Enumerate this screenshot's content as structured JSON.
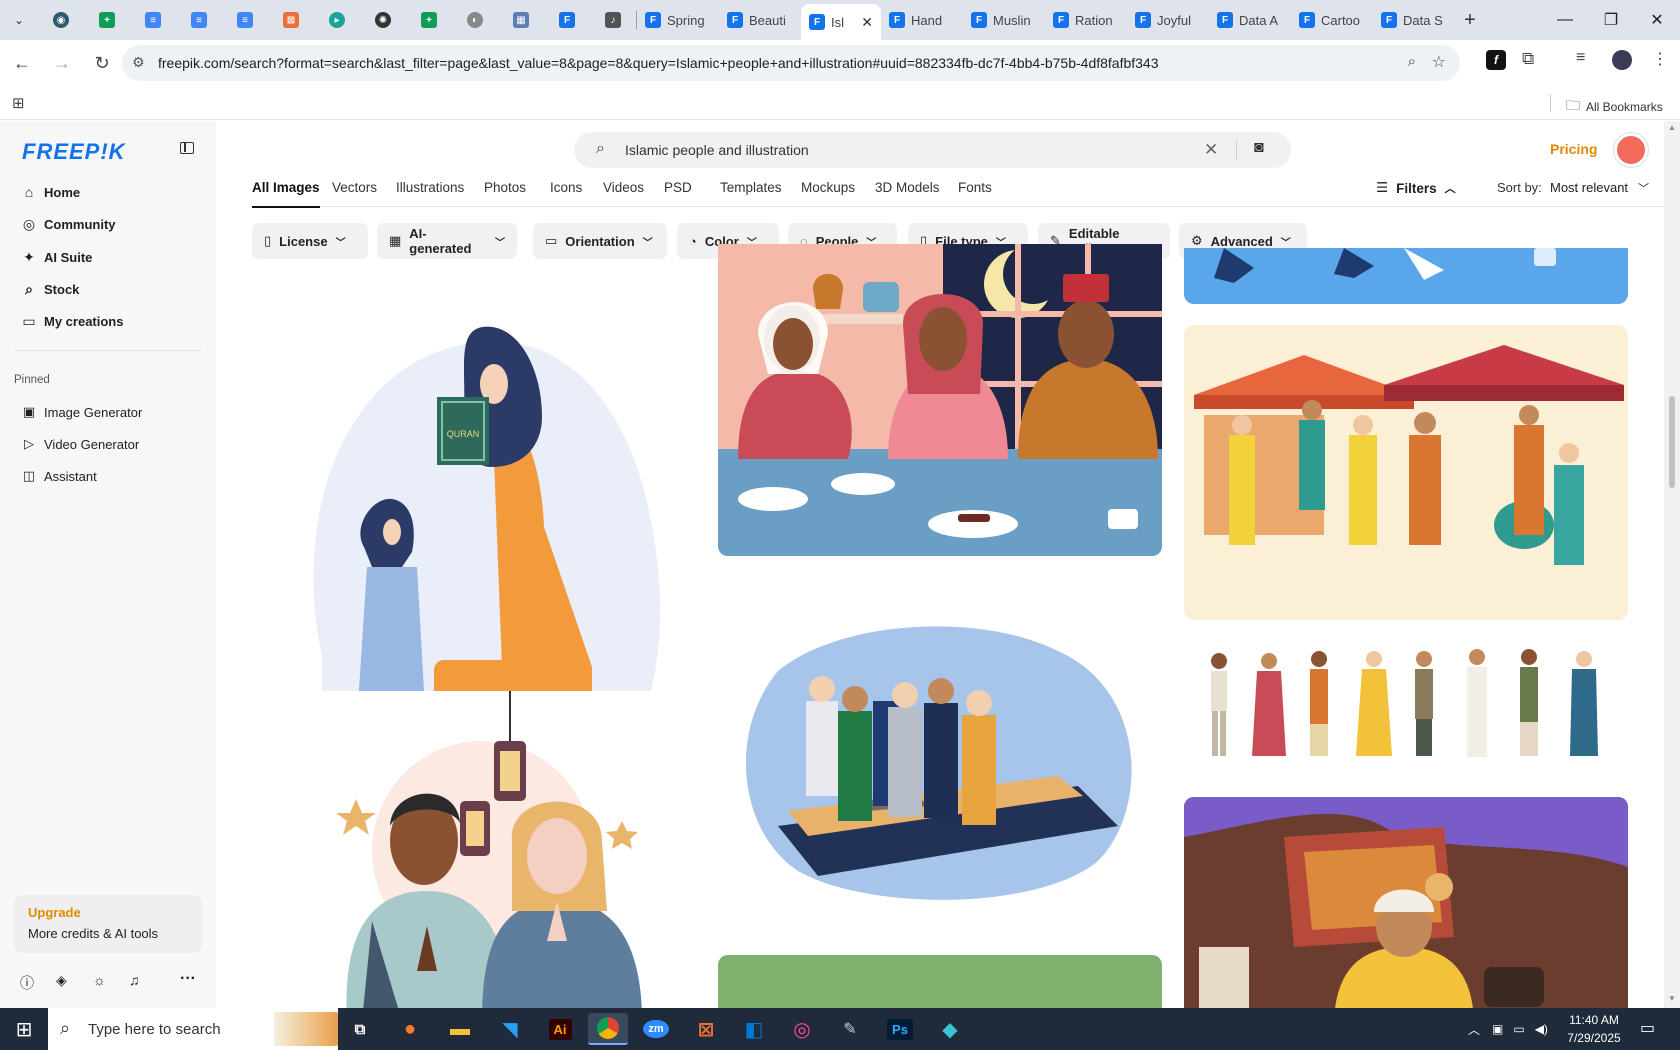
{
  "browser": {
    "tabs": [
      {
        "label": "Spring"
      },
      {
        "label": "Beauti"
      },
      {
        "label": "Isl"
      },
      {
        "label": "Hand"
      },
      {
        "label": "Muslin"
      },
      {
        "label": "Ration"
      },
      {
        "label": "Joyful"
      },
      {
        "label": "Data A"
      },
      {
        "label": "Cartoo"
      },
      {
        "label": "Data S"
      }
    ],
    "url": "freepik.com/search?format=search&last_filter=page&last_value=8&page=8&query=Islamic+people+and+illustration#uuid=882334fb-dc7f-4bb4-b75b-4df8fafbf343",
    "bookmarks_label": "All Bookmarks"
  },
  "sidebar": {
    "logo": "FREEP!K",
    "nav": [
      {
        "label": "Home",
        "icon": "home-icon"
      },
      {
        "label": "Community",
        "icon": "globe-icon"
      },
      {
        "label": "AI Suite",
        "icon": "sparkle-icon"
      },
      {
        "label": "Stock",
        "icon": "search-icon"
      },
      {
        "label": "My creations",
        "icon": "folder-icon"
      }
    ],
    "pinned_title": "Pinned",
    "pinned": [
      {
        "label": "Image Generator",
        "icon": "image-icon"
      },
      {
        "label": "Video Generator",
        "icon": "video-icon"
      },
      {
        "label": "Assistant",
        "icon": "chat-icon"
      }
    ],
    "upgrade_title": "Upgrade",
    "upgrade_text": "More credits & AI tools"
  },
  "search": {
    "value": "Islamic people and illustration",
    "pricing": "Pricing"
  },
  "content_tabs": [
    "All Images",
    "Vectors",
    "Illustrations",
    "Photos",
    "Icons",
    "Videos",
    "PSD",
    "Templates",
    "Mockups",
    "3D Models",
    "Fonts"
  ],
  "filters": {
    "label": "Filters",
    "sort_label": "Sort by:",
    "sort_value": "Most relevant",
    "chips": [
      "License",
      "AI-generated",
      "Orientation",
      "Color",
      "People",
      "File type",
      "Editable online",
      "Advanced"
    ]
  },
  "tiles": {
    "quran_label": "QURAN"
  },
  "taskbar": {
    "search_placeholder": "Type here to search",
    "time": "11:40 AM",
    "date": "7/29/2025",
    "apps": [
      "Ai",
      "zm",
      "Ps"
    ]
  }
}
